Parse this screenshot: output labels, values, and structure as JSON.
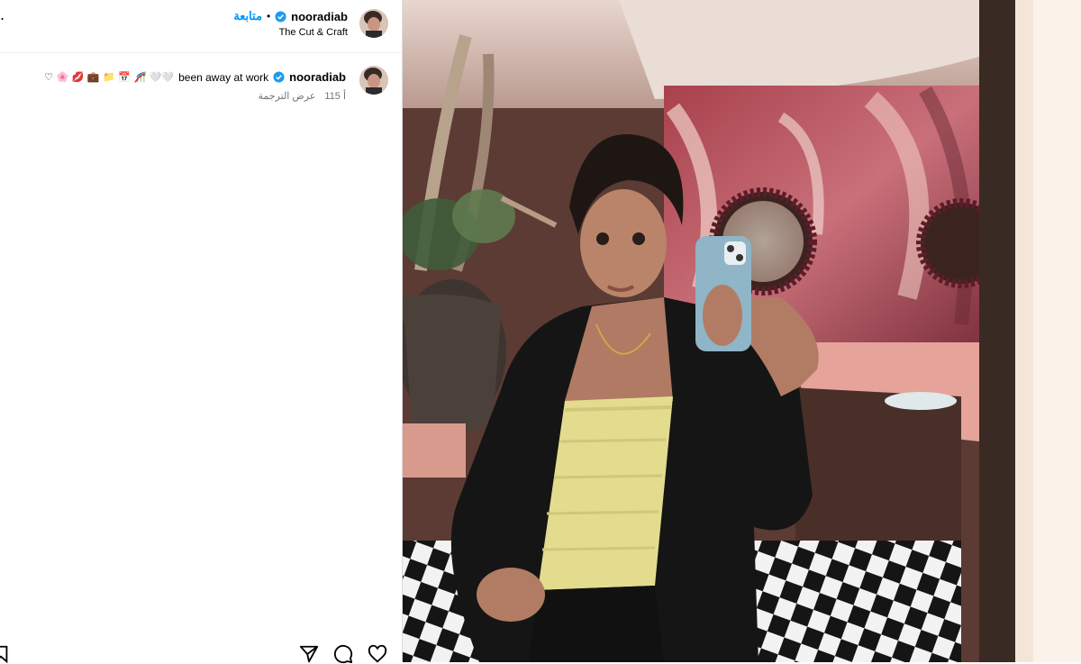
{
  "header": {
    "more_glyph": "..",
    "username": "nooradiab",
    "separator": "•",
    "follow_label": "متابعة",
    "subtitle": "The Cut & Craft"
  },
  "caption": {
    "username": "nooradiab",
    "text": "been away at work",
    "emojis": "♡ 🌸 💋 💼 📁 📅 🎢 🤍🤍",
    "likes": "115 أ",
    "translate_label": "عرض الترجمة"
  },
  "icons": {
    "verified": "verified-badge-icon",
    "heart": "heart-icon",
    "comment": "comment-icon",
    "share": "share-icon",
    "bookmark": "bookmark-icon"
  },
  "colors": {
    "accent": "#0095f6",
    "verified": "#1d9bf0",
    "muted": "#737373",
    "text": "#000000"
  }
}
